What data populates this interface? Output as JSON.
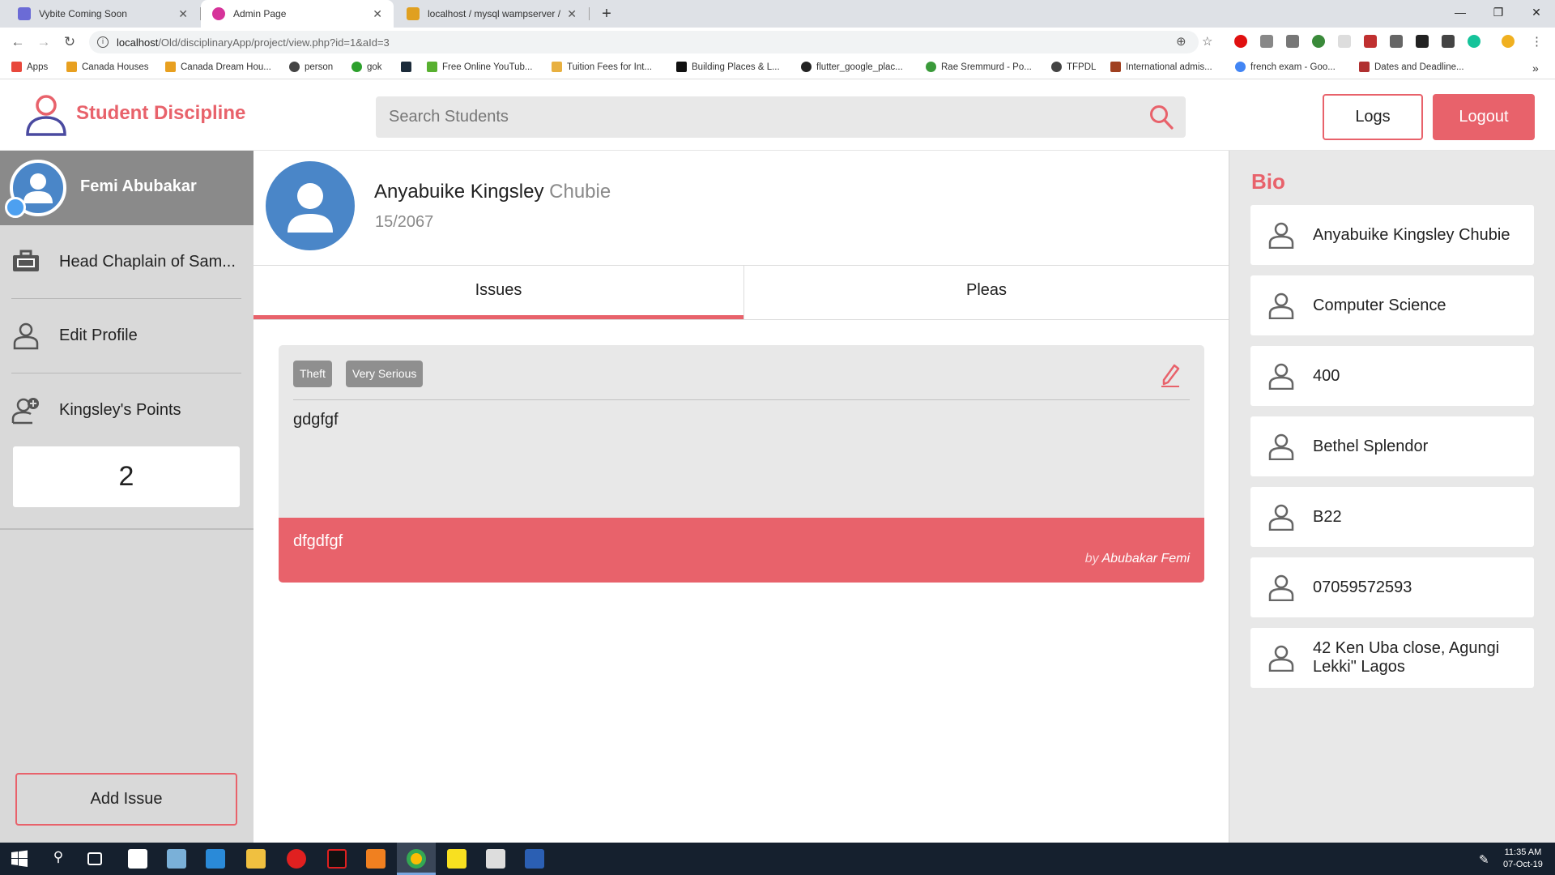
{
  "browser": {
    "tabs": [
      {
        "title": "Vybite Coming Soon",
        "favicon_color": "#6b6bd6",
        "active": false
      },
      {
        "title": "Admin Page",
        "favicon_color": "#d6339a",
        "active": true
      },
      {
        "title": "localhost / mysql wampserver / s",
        "favicon_color": "#e0a020",
        "active": false
      }
    ],
    "new_tab_icon": "plus-icon",
    "url_host": "localhost",
    "url_path": "/Old/disciplinaryApp/project/view.php?id=1&aId=3",
    "bookmarks": [
      {
        "label": "Apps",
        "color": "#e8483c"
      },
      {
        "label": "Canada Houses",
        "color": "#e8a020"
      },
      {
        "label": "Canada Dream Hou...",
        "color": "#e8a020"
      },
      {
        "label": "person",
        "color": "#444444"
      },
      {
        "label": "gok",
        "color": "#2ca02c"
      },
      {
        "label": "",
        "color": "#1c2b3a"
      },
      {
        "label": "Free Online YouTub...",
        "color": "#58b030"
      },
      {
        "label": "Tuition Fees for Int...",
        "color": "#e8b040"
      },
      {
        "label": "Building Places & L...",
        "color": "#111111"
      },
      {
        "label": "flutter_google_plac...",
        "color": "#222222"
      },
      {
        "label": "Rae Sremmurd - Po...",
        "color": "#3a9a3a"
      },
      {
        "label": "TFPDL",
        "color": "#444444"
      },
      {
        "label": "International admis...",
        "color": "#a04020"
      },
      {
        "label": "french exam - Goo...",
        "color": "#4285f4"
      },
      {
        "label": "Dates and Deadline...",
        "color": "#b03030"
      }
    ]
  },
  "header": {
    "brand": "Student Discipline",
    "search_placeholder": "Search Students",
    "logs_label": "Logs",
    "logout_label": "Logout"
  },
  "sidebar": {
    "user_name": "Femi Abubakar",
    "items": [
      {
        "label": "Head Chaplain of Sam...",
        "icon": "briefcase-icon"
      },
      {
        "label": "Edit Profile",
        "icon": "user-icon"
      },
      {
        "label": "Kingsley's Points",
        "icon": "user-plus-icon"
      }
    ],
    "points": "2",
    "add_issue_label": "Add Issue"
  },
  "student": {
    "first_name": "Anyabuike Kingsley",
    "middle_name": "Chubie",
    "reg_number": "15/2067"
  },
  "tabs": {
    "issues_label": "Issues",
    "pleas_label": "Pleas"
  },
  "issue": {
    "tags": [
      "Theft",
      "Very Serious"
    ],
    "description": "gdgfgf",
    "note": "dfgdfgf",
    "author_prefix": "by",
    "author": "Abubakar Femi"
  },
  "bio": {
    "title": "Bio",
    "items": [
      "Anyabuike Kingsley Chubie",
      "Computer Science",
      "400",
      "Bethel Splendor",
      "B22",
      "07059572593",
      "42 Ken Uba close, Agungi Lekki\" Lagos"
    ]
  },
  "taskbar": {
    "time": "11:35 AM",
    "date": "07-Oct-19"
  },
  "colors": {
    "accent": "#e8626b",
    "avatar_blue": "#4a86c8",
    "sidebar_bg": "#d9d9d9",
    "tag_gray": "#8f8f8f"
  }
}
